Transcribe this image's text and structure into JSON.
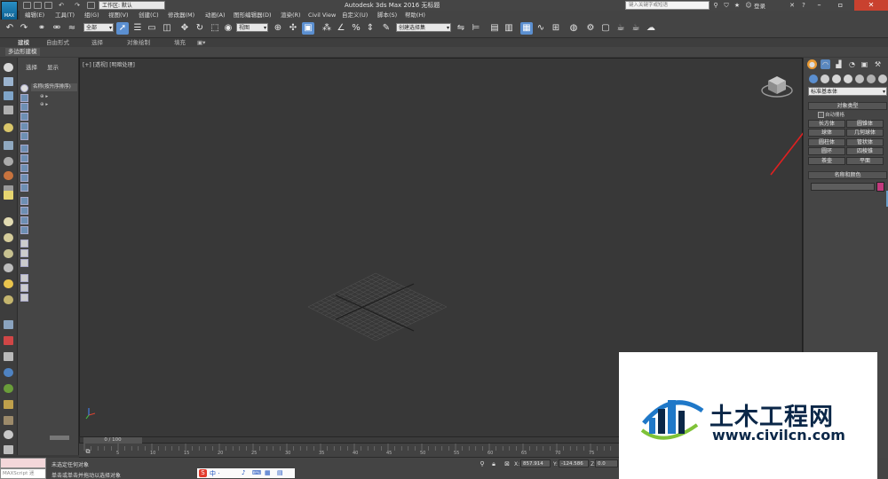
{
  "app": {
    "logo_text": "MAX",
    "title": "Autodesk 3ds Max 2016    无标题",
    "workspace_label": "工作区: 默认",
    "search_placeholder": "键入关键字或短语",
    "login": "登录"
  },
  "menu": [
    "编辑(E)",
    "工具(T)",
    "组(G)",
    "视图(V)",
    "创建(C)",
    "修改器(M)",
    "动画(A)",
    "图形编辑器(D)",
    "渲染(R)",
    "Civil View",
    "自定义(U)",
    "脚本(S)",
    "帮助(H)"
  ],
  "toolbar": {
    "selection_filter": "全部",
    "view_dropdown": "视图",
    "named_selection": "创建选择集"
  },
  "ribbon": {
    "tabs": [
      "建模",
      "自由形式",
      "选择",
      "对象绘制",
      "填充"
    ],
    "active_tab": "建模",
    "poly_modeling": "多边形建模"
  },
  "explorer": {
    "tabs": [
      "选择",
      "显示"
    ],
    "column_header": "名称(按升序排序)"
  },
  "viewport": {
    "label": "[+] [透视] [明暗处理]"
  },
  "timeline": {
    "frame_display": "0 / 100",
    "ticks": [
      "0",
      "5",
      "10",
      "15",
      "20",
      "25",
      "30",
      "35",
      "40",
      "45",
      "50",
      "55",
      "60",
      "65",
      "70",
      "75"
    ]
  },
  "status": {
    "maxscript_label": "MAXScript 迷",
    "line1": "未选定任何对象",
    "line2": "单击或单击并拖动以选择对象",
    "x_label": "X:",
    "x_value": "857.914",
    "y_label": "Y:",
    "y_value": "-124.586",
    "z_label": "Z:",
    "z_value": "0.0"
  },
  "ime": {
    "logo": "S",
    "text": "中 ·"
  },
  "command_panel": {
    "category_dropdown": "标准基本体",
    "rollout_object_type": "对象类型",
    "autogrid": "自动栅格",
    "buttons": [
      "长方体",
      "圆锥体",
      "球体",
      "几何球体",
      "圆柱体",
      "管状体",
      "圆环",
      "四棱锥",
      "茶壶",
      "平面"
    ],
    "rollout_name_color": "名称和颜色",
    "swatch_color": "#c23a7d"
  },
  "watermark": {
    "title": "土木工程网",
    "url": "www.civilcn.com"
  },
  "colors": {
    "annotation_arrow": "#e02020",
    "selected_tool": "#5b8fd0"
  }
}
